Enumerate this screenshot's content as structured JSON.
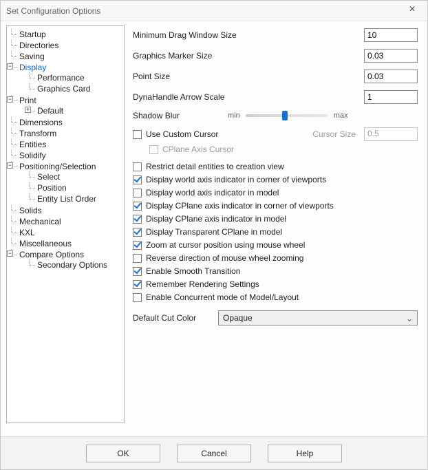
{
  "window": {
    "title": "Set Configuration Options",
    "close_glyph": "✕"
  },
  "tree": {
    "startup": "Startup",
    "directories": "Directories",
    "saving": "Saving",
    "display": "Display",
    "performance": "Performance",
    "graphics_card": "Graphics Card",
    "print": "Print",
    "default": "Default",
    "dimensions": "Dimensions",
    "transform": "Transform",
    "entities": "Entities",
    "solidify": "Solidify",
    "pos_sel": "Positioning/Selection",
    "select": "Select",
    "position": "Position",
    "entity_list_order": "Entity List Order",
    "solids": "Solids",
    "mechanical": "Mechanical",
    "kxl": "KXL",
    "miscellaneous": "Miscellaneous",
    "compare_options": "Compare Options",
    "secondary_options": "Secondary Options",
    "glyph_minus": "−",
    "glyph_plus": "+"
  },
  "form": {
    "min_drag_label": "Minimum Drag Window Size",
    "min_drag_value": "10",
    "marker_label": "Graphics Marker Size",
    "marker_value": "0.03",
    "point_label": "Point Size",
    "point_value": "0.03",
    "dyna_label": "DynaHandle Arrow Scale",
    "dyna_value": "1",
    "shadow_label": "Shadow Blur",
    "shadow_min": "min",
    "shadow_max": "max",
    "shadow_slider_pct": 48,
    "use_custom_cursor": "Use Custom Cursor",
    "cursor_size_label": "Cursor Size",
    "cursor_size_value": "0.5",
    "cplane_axis_cursor": "CPlane Axis Cursor",
    "restrict_detail": "Restrict detail entities to creation view",
    "world_axis_viewports": "Display world axis indicator in corner of viewports",
    "world_axis_model": "Display world axis indicator in model",
    "cplane_axis_viewports": "Display CPlane axis indicator in corner of viewports",
    "cplane_axis_model": "Display CPlane axis indicator in model",
    "transparent_cplane": "Display Transparent CPlane in model",
    "zoom_cursor": "Zoom at cursor position using mouse wheel",
    "reverse_zoom": "Reverse direction of mouse wheel zooming",
    "smooth_transition": "Enable Smooth Transition",
    "remember_render": "Remember Rendering Settings",
    "concurrent_mode": "Enable Concurrent mode of Model/Layout",
    "default_cut_label": "Default Cut Color",
    "default_cut_value": "Opaque",
    "chev": "⌄"
  },
  "footer": {
    "ok": "OK",
    "cancel": "Cancel",
    "help": "Help"
  }
}
